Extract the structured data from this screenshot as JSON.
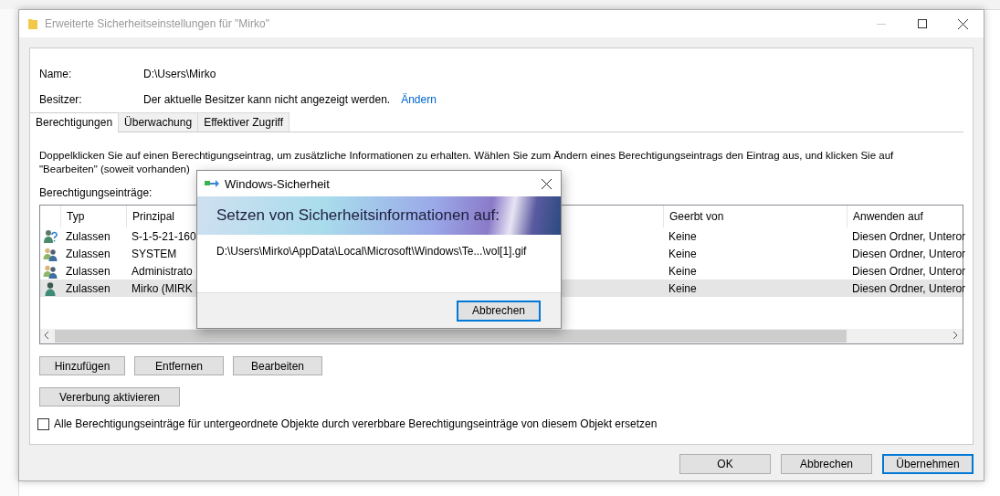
{
  "window": {
    "title": "Erweiterte Sicherheitseinstellungen für \"Mirko\""
  },
  "name": {
    "label": "Name:",
    "value": "D:\\Users\\Mirko"
  },
  "owner": {
    "label": "Besitzer:",
    "value": "Der aktuelle Besitzer kann nicht angezeigt werden.",
    "link": "Ändern"
  },
  "tabs": [
    {
      "label": "Berechtigungen",
      "selected": true
    },
    {
      "label": "Überwachung",
      "selected": false
    },
    {
      "label": "Effektiver Zugriff",
      "selected": false
    }
  ],
  "description": "Doppelklicken Sie auf einen Berechtigungseintrag, um zusätzliche Informationen zu erhalten. Wählen Sie zum Ändern eines Berechtigungseintrags den Eintrag aus, und klicken Sie auf \"Bearbeiten\" (soweit vorhanden)",
  "list_label": "Berechtigungseinträge:",
  "table": {
    "columns": [
      "Typ",
      "Prinzipal",
      "Geerbt von",
      "Anwenden auf"
    ],
    "rows": [
      {
        "kind": "unknown",
        "type": "Zulassen",
        "principal": "S-1-5-21-160",
        "inherited": "Keine",
        "applies": "Diesen Ordner, Unteror",
        "selected": false
      },
      {
        "kind": "group",
        "type": "Zulassen",
        "principal": "SYSTEM",
        "inherited": "Keine",
        "applies": "Diesen Ordner, Unteror",
        "selected": false
      },
      {
        "kind": "group",
        "type": "Zulassen",
        "principal": "Administrato",
        "inherited": "Keine",
        "applies": "Diesen Ordner, Unteror",
        "selected": false
      },
      {
        "kind": "user",
        "type": "Zulassen",
        "principal": "Mirko (MIRK",
        "inherited": "Keine",
        "applies": "Diesen Ordner, Unteror",
        "selected": true
      }
    ]
  },
  "entry_buttons": [
    "Hinzufügen",
    "Entfernen",
    "Bearbeiten"
  ],
  "inheritance_button": "Vererbung aktivieren",
  "replace_checkbox": {
    "label": "Alle Berechtigungseinträge für untergeordnete Objekte durch vererbbare Berechtigungseinträge von diesem Objekt ersetzen",
    "checked": false
  },
  "footer_buttons": [
    {
      "label": "OK",
      "focused": false
    },
    {
      "label": "Abbrechen",
      "focused": false
    },
    {
      "label": "Übernehmen",
      "focused": true
    }
  ],
  "progress_dialog": {
    "title": "Windows-Sicherheit",
    "heading": "Setzen von Sicherheitsinformationen auf:",
    "path": "D:\\Users\\Mirko\\AppData\\Local\\Microsoft\\Windows\\Te...\\vol[1].gif",
    "button": "Abbrechen"
  }
}
